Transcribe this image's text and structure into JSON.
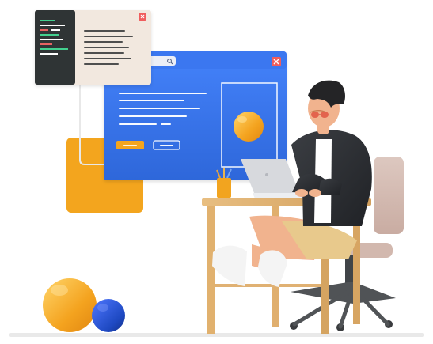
{
  "colors": {
    "blue_window": "#3B78F0",
    "blue_window_dark": "#2F66D8",
    "blue_inner_panel": "#3F80F5",
    "white": "#FFFFFF",
    "orange": "#F3A51E",
    "orange_dark": "#E48D12",
    "orange_light": "#F8C85A",
    "cream_window": "#F2E8DF",
    "dark_code_panel": "#2F3435",
    "close_red": "#F05D5D",
    "wood": "#E3B170",
    "wood_dark": "#C99454",
    "floor": "#F2F2F2",
    "man_shirt": "#FFFFFF",
    "man_jacket": "#2F3134",
    "man_shorts": "#E8C98C",
    "skin": "#F1B38E",
    "shoe": "#F4F4F4",
    "chair": "#D8C1B8",
    "chair_dark": "#BFA39A",
    "laptop": "#D7D9DD",
    "blue_ball": "#1E49C2"
  },
  "icons": {
    "search": "search-icon",
    "close": "close-icon"
  }
}
